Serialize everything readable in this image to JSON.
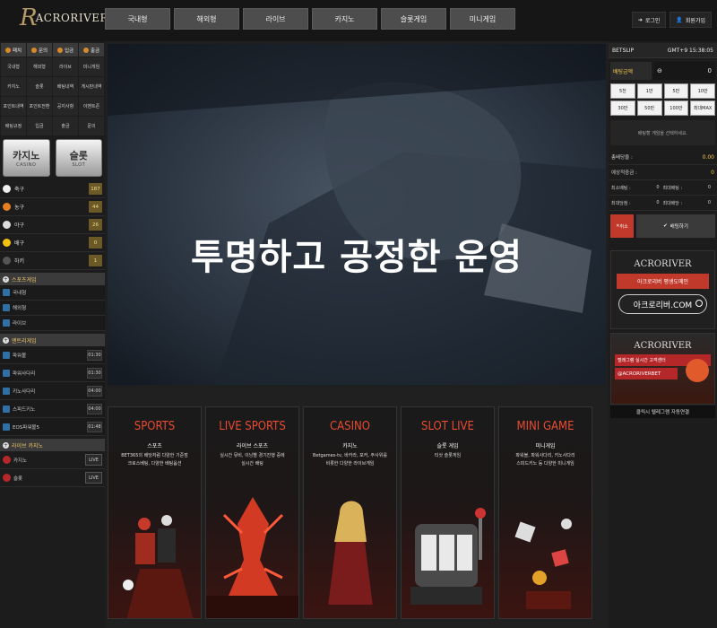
{
  "brand": {
    "mark": "R",
    "name": "ACRORIVER"
  },
  "nav": {
    "items": [
      "국내형",
      "해외형",
      "라이브",
      "카지노",
      "슬롯게임",
      "미니게임"
    ]
  },
  "account": {
    "login": "로그인",
    "signup": "회원가입"
  },
  "left": {
    "quick": [
      "입금",
      "출금",
      "입금",
      "출금"
    ],
    "quick_labels": [
      "패치",
      "문의",
      "입금",
      "출금"
    ],
    "menu": [
      "국내형",
      "해외형",
      "라이브",
      "미니게임",
      "카지노",
      "슬롯",
      "배팅내역",
      "게시판내역",
      "포인트내역",
      "포인트전환",
      "공지사항",
      "이벤트존",
      "배팅규정",
      "입금",
      "출금",
      "문의"
    ],
    "casino": {
      "k": "카지노",
      "e": "CASINO"
    },
    "slot": {
      "k": "슬롯",
      "e": "SLOT"
    },
    "sports": [
      {
        "name": "축구",
        "count": "187",
        "color": "#eeeeee"
      },
      {
        "name": "농구",
        "count": "44",
        "color": "#e67e22"
      },
      {
        "name": "야구",
        "count": "26",
        "color": "#dddddd"
      },
      {
        "name": "배구",
        "count": "0",
        "color": "#f1c40f"
      },
      {
        "name": "하키",
        "count": "1",
        "color": "#555555"
      }
    ],
    "sports_game_title": "스포츠게임",
    "sports_game": [
      "국내형",
      "해외형",
      "라이브"
    ],
    "mini_title": "엔트리게임",
    "mini": [
      {
        "name": "파워볼",
        "time": "01:30"
      },
      {
        "name": "파워사다리",
        "time": "01:30"
      },
      {
        "name": "키노사다리",
        "time": "04:00"
      },
      {
        "name": "스피드키노",
        "time": "04:00"
      },
      {
        "name": "EOS파워볼5",
        "time": "01:48"
      }
    ],
    "live_title": "라이브 카지노",
    "live": [
      {
        "name": "카지노",
        "badge": "LIVE"
      },
      {
        "name": "슬롯",
        "badge": "LIVE"
      }
    ]
  },
  "banner": {
    "headline": "투명하고 공정한 운영"
  },
  "categories": [
    {
      "title": "SPORTS",
      "ko": "스포츠",
      "desc": "BET365의 배당처럼 다양한 기준점\n크로스베팅, 다양한 배팅옵션"
    },
    {
      "title": "LIVE SPORTS",
      "ko": "라이브 스포츠",
      "desc": "실시간 뮤비, 이닝별 경기진행 중에\n실시간 배팅"
    },
    {
      "title": "CASINO",
      "ko": "카지노",
      "desc": "Betgames-tv, 바카라, 포커, 주사위를\n비롯한 다양한 라이브게임"
    },
    {
      "title": "SLOT LIVE",
      "ko": "슬롯 게임",
      "desc": "티삿 슬롯게임"
    },
    {
      "title": "MINI GAME",
      "ko": "미니게임",
      "desc": "파워볼, 파워사다리, 키노사다리\n스피드키노 등 다양한 미니게임"
    }
  ],
  "betslip": {
    "title": "BETSLIP",
    "clock": "GMT+9 15:38:05",
    "stake_label": "배팅금액",
    "stake_value": "0",
    "chips": [
      "5천",
      "1만",
      "5만",
      "10만",
      "30만",
      "50만",
      "100만",
      "최대MAX"
    ],
    "empty": "배팅할 게임을 선택하세요.",
    "rows": [
      {
        "label": "총배당율 :",
        "value": "0.00"
      },
      {
        "label": "예상적중금 :",
        "value": "0"
      }
    ],
    "limits": [
      [
        {
          "l": "최소배팅 :",
          "v": "0"
        },
        {
          "l": "최대배팅 :",
          "v": "0"
        }
      ],
      [
        {
          "l": "최대당첨 :",
          "v": "0"
        },
        {
          "l": "최대배당 :",
          "v": "0"
        }
      ]
    ],
    "cancel": "취소",
    "bet": "배팅하기"
  },
  "promo1": {
    "title": "ACRORIVER",
    "button": "아크로리버 평생도메인",
    "domain": "아크로리버.COM"
  },
  "promo2": {
    "title": "ACRORIVER",
    "line1": "텔레그램 실시간 고객센터",
    "line2": "@ACRORIVERBET"
  },
  "telegram_bar": "클릭시 텔레그램 자동연결"
}
